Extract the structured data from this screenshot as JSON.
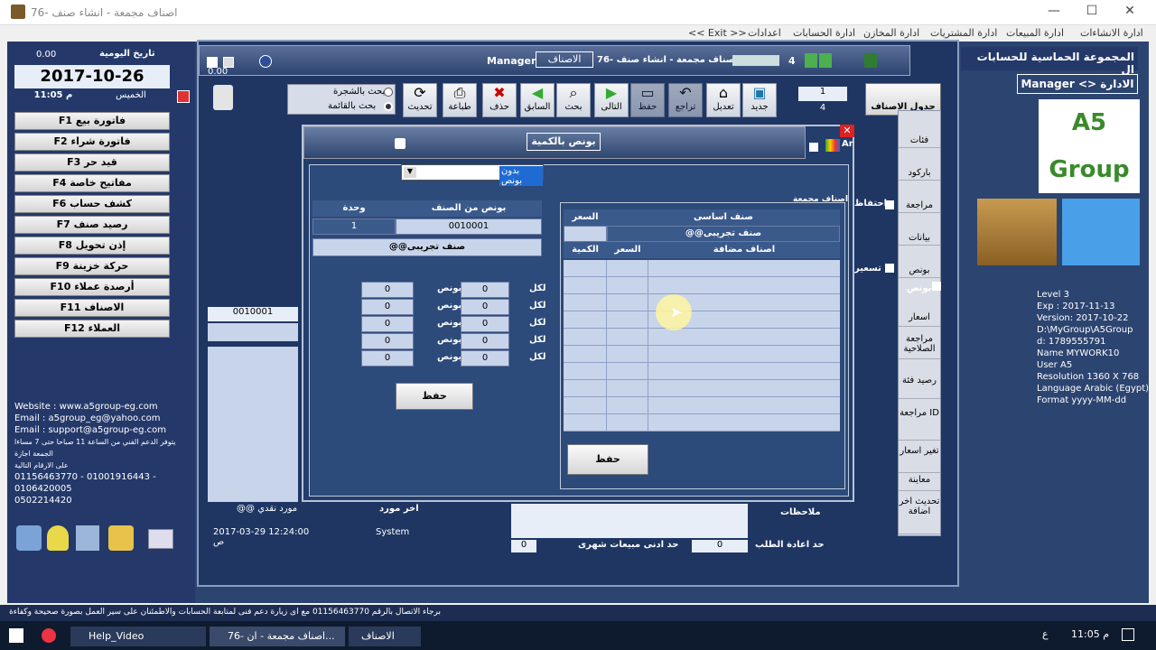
{
  "window": {
    "title": "76- اصناف مجمعة - انشاء صنف",
    "controls": [
      "—",
      "☐",
      "✕"
    ]
  },
  "menubar": {
    "items": [
      "ادارة الانشاءات",
      "ادارة المبيعات",
      "ادارة المشتريات",
      "ادارة المخازن",
      "ادارة الحسابات",
      "اعدادات",
      "<< Exit >>"
    ]
  },
  "left_panel": {
    "counter": "0.00",
    "date_label": "تاريخ اليومية",
    "date": "2017-10-26",
    "time": "11:05 م",
    "day": "الخميس",
    "fkeys": [
      "F1 فاتورة بيع",
      "F2 فاتورة شراء",
      "F3 قيد حر",
      "F4 مفاتيح خاصة",
      "F6 كشف حساب",
      "F7 رصيد صنف",
      "F8 إذن تحويل",
      "F9 حركة خزينة",
      "F10 أرصدة عملاء",
      "F11 الاصناف",
      "F12 العملاء"
    ],
    "website": "Website : www.a5group-eg.com",
    "email1": "Email : a5group_eg@yahoo.com",
    "email2": "Email : support@a5group-eg.com",
    "support_note": "يتوفر الدعم الفني من الساعة 11 صباحا حتى 7 مساءا",
    "holiday": "الجمعة اجازة",
    "numbers_note": "على الارقام التالية",
    "phones": "01156463770 - 01001916443 - 0106420005",
    "phone2": "0502214420"
  },
  "main_window": {
    "header_title": "76- اصناف مجمعة - انشاء صنف",
    "tab_active": "الاصناف",
    "user": "Manager",
    "counter": "0.00",
    "nav_value": "4",
    "search_tree": "بحث بالشجرة",
    "search_list": "بحث بالقائمة",
    "toolbar": [
      {
        "label": "جديد",
        "icon": "new-icon"
      },
      {
        "label": "تعديل",
        "icon": "edit-icon"
      },
      {
        "label": "تراجع",
        "icon": "undo-icon"
      },
      {
        "label": "حفظ",
        "icon": "save-icon"
      },
      {
        "label": "التالى",
        "icon": "next-icon"
      },
      {
        "label": "بحث",
        "icon": "search-icon"
      },
      {
        "label": "السابق",
        "icon": "prev-icon"
      },
      {
        "label": "حذف",
        "icon": "delete-icon"
      },
      {
        "label": "طباعة",
        "icon": "print-icon"
      },
      {
        "label": "تحديث",
        "icon": "refresh-icon"
      }
    ],
    "record_pos": "1",
    "record_total": "4",
    "items_table_btn": "جدول الاصناف",
    "side_buttons": [
      "فئات",
      "باركود",
      "مراجعة",
      "بيانات",
      "بونص",
      "اسعار",
      "مراجعة الصلاحية",
      "رصيد فئة",
      "مراجعة ID",
      "تغير اسعار",
      "معاينة",
      "تحديث اخر اضافة"
    ],
    "left_code": "0010001",
    "supplier_label": "اخر مورد",
    "supplier_value": "@@ مورد نقدي",
    "created_date": "2017-03-29 12:24:00 ص",
    "created_by": "System",
    "notes_label": "ملاحظات",
    "reorder_label": "حد اعادة الطلب",
    "reorder_value": "0",
    "min_sales_label": "حد ادنى مبيعات شهرى",
    "min_sales_value": "0",
    "grouped_checkbox": "اصناف مجمعة",
    "ext_label": "احتفاظ",
    "price_label": "تسعير",
    "bonus_checkbox": "بونص"
  },
  "dialog": {
    "title": "بونص بالكمية",
    "lang": "Ar",
    "dropdown_value": "بدون بونص",
    "bonus_item_hdr": "بونص من الصنف",
    "unit_hdr": "وحدة",
    "item_code": "0010001",
    "unit_value": "1",
    "item_name": "@@صنف تجريبى",
    "bonus_rows": [
      {
        "for": "لكل",
        "qty": "0",
        "bonus_lbl": "بونص",
        "bonus": "0"
      },
      {
        "for": "لكل",
        "qty": "0",
        "bonus_lbl": "بونص",
        "bonus": "0"
      },
      {
        "for": "لكل",
        "qty": "0",
        "bonus_lbl": "بونص",
        "bonus": "0"
      },
      {
        "for": "لكل",
        "qty": "0",
        "bonus_lbl": "بونص",
        "bonus": "0"
      },
      {
        "for": "لكل",
        "qty": "0",
        "bonus_lbl": "بونص",
        "bonus": "0"
      }
    ],
    "save_left": "حفظ",
    "grouped_title": "اصناف مجمعة",
    "base_item_hdr": "صنف اساسى",
    "price_hdr": "السعر",
    "base_item_value": "@@صنف تجريبى",
    "added_hdr": "اصناف مضافة",
    "added_price_hdr": "السعر",
    "qty_hdr": "الكمية",
    "save_right": "حفظ"
  },
  "right_panel": {
    "company": "المجموعة الحماسية للحسابات ال",
    "role": "Manager <> الادارة",
    "logo_text": "A5 Group",
    "level": "Level 3",
    "exp": "Exp : 2017-11-13",
    "version": "Version: 2017-10-22",
    "path": "D:\\MyGroup\\A5Group",
    "id": "d: 1789555791",
    "name": "Name MYWORK10",
    "user": "User A5",
    "resolution": "Resolution 1360 X 768",
    "language": "Language Arabic (Egypt)",
    "format": "Format yyyy-MM-dd"
  },
  "status_text": "برجاء الاتصال بالرقم 01156463770 مع اى زيارة دعم فنى لمتابعة الحسابات والاطمئنان على سير العمل بصورة صحيحة وكفاءة منتدبينا",
  "taskbar": {
    "items": [
      "Help_Video",
      "76- اصناف مجمعة - ان...",
      "الاصناف"
    ],
    "time": "11:05 م",
    "lang": "ع"
  },
  "colors": {
    "desktop_blue": "#2c4470",
    "panel_dark": "#24396a",
    "cell_blue": "#c8d4ea",
    "cursor_highlight": "#fff6a0"
  }
}
